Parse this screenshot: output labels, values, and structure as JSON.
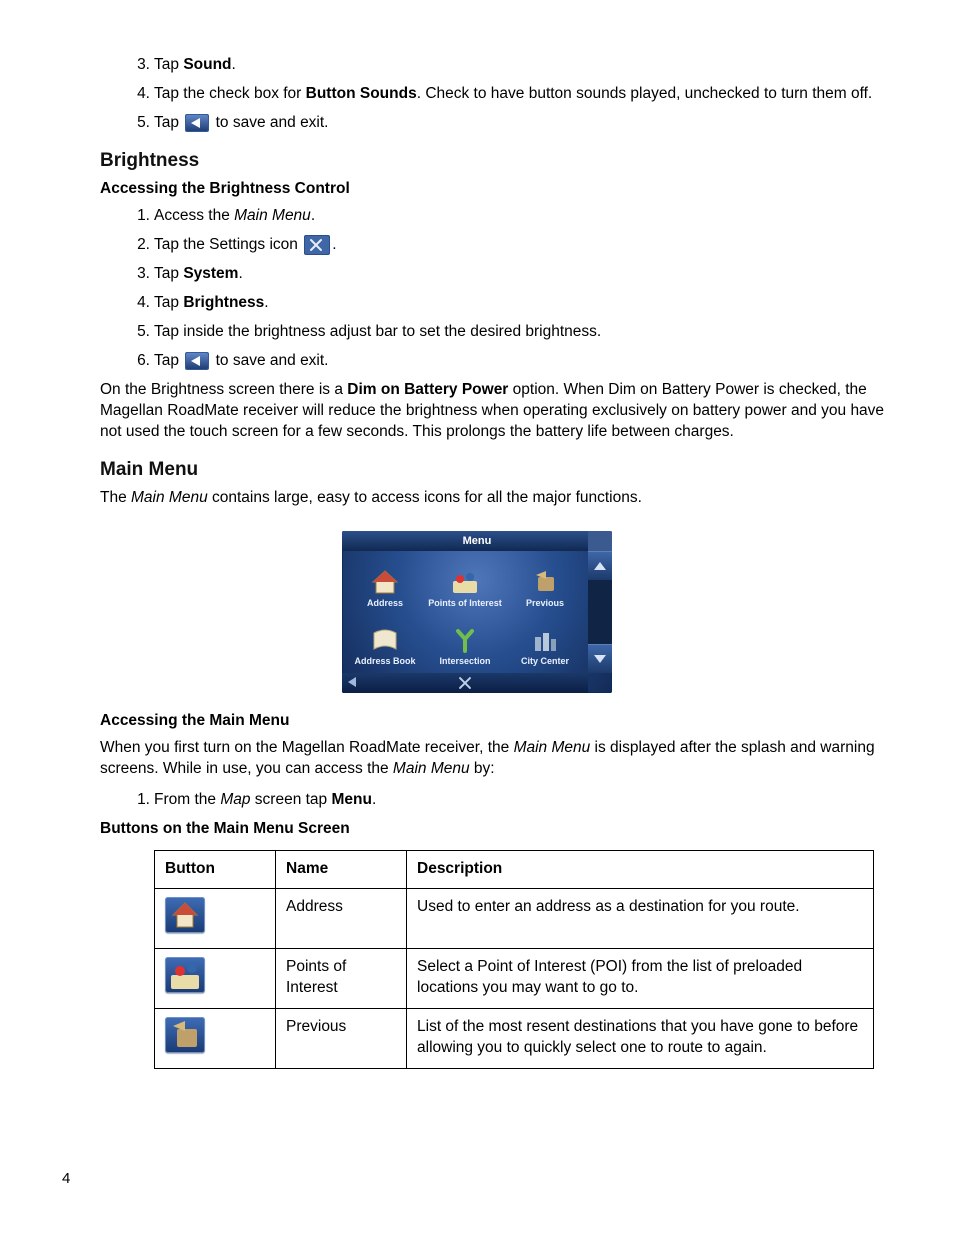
{
  "page_number": "4",
  "topList": [
    {
      "n": "3.",
      "parts": [
        "Tap ",
        {
          "b": "Sound"
        },
        "."
      ]
    },
    {
      "n": "4.",
      "parts": [
        "Tap the check box for ",
        {
          "b": "Button Sounds"
        },
        ".  Check to have button sounds played, unchecked to turn them off."
      ]
    },
    {
      "n": "5.",
      "parts": [
        "Tap ",
        {
          "icon": "back"
        },
        " to save and exit."
      ]
    }
  ],
  "brightness": {
    "heading": "Brightness",
    "sub": "Accessing the Brightness Control",
    "list": [
      {
        "n": "1.",
        "parts": [
          "Access the ",
          {
            "i": "Main Menu"
          },
          "."
        ]
      },
      {
        "n": "2.",
        "parts": [
          "Tap the Settings icon ",
          {
            "icon": "settings"
          },
          "."
        ]
      },
      {
        "n": "3.",
        "parts": [
          "Tap ",
          {
            "b": "System"
          },
          "."
        ]
      },
      {
        "n": "4.",
        "parts": [
          "Tap ",
          {
            "b": "Brightness"
          },
          "."
        ]
      },
      {
        "n": "5.",
        "parts": [
          "Tap inside the brightness adjust bar to set the desired brightness."
        ]
      },
      {
        "n": "6.",
        "parts": [
          "Tap ",
          {
            "icon": "back"
          },
          " to save and exit."
        ]
      }
    ],
    "para": [
      "On the Brightness screen there is a ",
      {
        "b": "Dim on Battery Power"
      },
      " option. When Dim on Battery Power is checked, the Magellan RoadMate receiver will reduce the brightness when operating exclusively on battery power and you have not used the touch screen for a few seconds. This prolongs the battery life between charges."
    ]
  },
  "mainmenu": {
    "heading": "Main Menu",
    "intro": [
      "The ",
      {
        "i": "Main Menu"
      },
      " contains large, easy to access icons for all the major functions."
    ],
    "figure": {
      "title": "Menu",
      "cells": [
        "Address",
        "Points of Interest",
        "Previous",
        "Address Book",
        "Intersection",
        "City Center"
      ]
    },
    "sub1": "Accessing the Main Menu",
    "para1": [
      "When you first turn on the Magellan RoadMate receiver, the ",
      {
        "i": "Main Menu"
      },
      " is displayed after the splash and warning screens. While in use, you can access the ",
      {
        "i": "Main Menu"
      },
      " by:"
    ],
    "list1": [
      {
        "n": "1.",
        "parts": [
          "From the ",
          {
            "i": "Map"
          },
          " screen tap ",
          {
            "b": "Menu"
          },
          "."
        ]
      }
    ],
    "sub2": "Buttons on the Main Menu Screen",
    "table": {
      "headers": [
        "Button",
        "Name",
        "Description"
      ],
      "rows": [
        {
          "icon": "address",
          "name": "Address",
          "desc": "Used to enter an address as a destination for you route."
        },
        {
          "icon": "poi",
          "name": "Points of Interest",
          "desc": "Select a Point of Interest (POI) from the list of preloaded locations you may want to go to."
        },
        {
          "icon": "previous",
          "name": "Previous",
          "desc": "List of the most resent destinations that you have gone to before allowing you to quickly select one to route to again."
        }
      ]
    }
  }
}
